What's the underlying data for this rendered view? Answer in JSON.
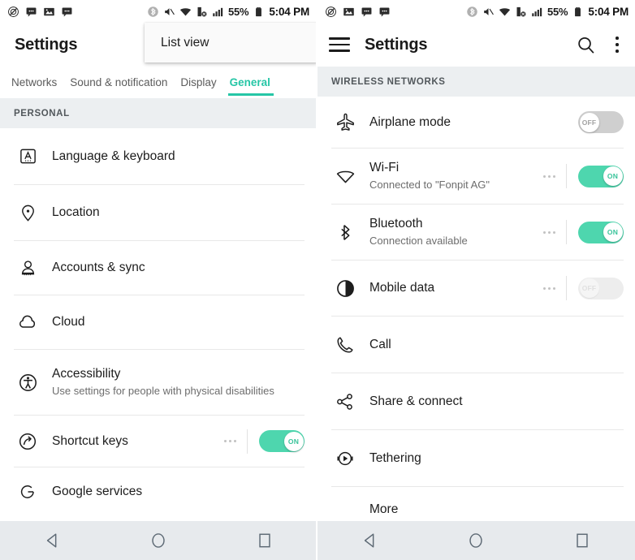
{
  "status_bar": {
    "left_icons_panel1": [
      "no-sound-icon",
      "message-icon",
      "photo-icon",
      "message-icon"
    ],
    "left_icons_panel2": [
      "no-sound-icon",
      "photo-icon",
      "message-icon",
      "message-icon"
    ],
    "bluetooth_icon": "bluetooth-icon",
    "mute_icon": "volume-mute-icon",
    "wifi_icon": "wifi-icon",
    "data_off_icon": "mobile-data-off-icon",
    "signal_icon": "signal-bars-icon",
    "battery_percent": "55%",
    "battery_icon": "battery-icon",
    "time": "5:04 PM"
  },
  "colors": {
    "accent": "#26c6a6",
    "toggle_on": "#4ed6ae",
    "toggle_off": "#cfcfcf",
    "section_bg": "#eceff1",
    "navbar_bg": "#e7eaed"
  },
  "left_panel": {
    "title": "Settings",
    "popup": {
      "label": "List view"
    },
    "tabs": [
      {
        "label": "Networks",
        "active": false
      },
      {
        "label": "Sound & notification",
        "active": false
      },
      {
        "label": "Display",
        "active": false
      },
      {
        "label": "General",
        "active": true
      }
    ],
    "section": {
      "label": "PERSONAL"
    },
    "items": [
      {
        "icon": "language-keyboard-icon",
        "label": "Language & keyboard",
        "sub": null,
        "toggle": null
      },
      {
        "icon": "location-pin-icon",
        "label": "Location",
        "sub": null,
        "toggle": null
      },
      {
        "icon": "accounts-sync-icon",
        "label": "Accounts & sync",
        "sub": null,
        "toggle": null
      },
      {
        "icon": "cloud-icon",
        "label": "Cloud",
        "sub": null,
        "toggle": null
      },
      {
        "icon": "accessibility-icon",
        "label": "Accessibility",
        "sub": "Use settings for people with physical disabilities",
        "toggle": null
      },
      {
        "icon": "shortcut-keys-icon",
        "label": "Shortcut keys",
        "sub": null,
        "toggle": "on",
        "toggle_label": "ON"
      },
      {
        "icon": "google-services-icon",
        "label": "Google services",
        "sub": null,
        "toggle": null
      }
    ]
  },
  "right_panel": {
    "title": "Settings",
    "menu_icon": "hamburger-icon",
    "search_icon": "search-icon",
    "overflow_icon": "overflow-menu-icon",
    "section": {
      "label": "WIRELESS NETWORKS"
    },
    "items": [
      {
        "icon": "airplane-icon",
        "label": "Airplane mode",
        "sub": null,
        "toggle": "off",
        "toggle_label": "OFF",
        "dots": false
      },
      {
        "icon": "wifi-icon",
        "label": "Wi-Fi",
        "sub": "Connected to \"Fonpit AG\"",
        "toggle": "on",
        "toggle_label": "ON",
        "dots": true
      },
      {
        "icon": "bluetooth-icon",
        "label": "Bluetooth",
        "sub": "Connection available",
        "toggle": "on",
        "toggle_label": "ON",
        "dots": true
      },
      {
        "icon": "mobile-data-icon",
        "label": "Mobile data",
        "sub": null,
        "toggle": "disabled",
        "toggle_label": "OFF",
        "dots": true
      },
      {
        "icon": "call-icon",
        "label": "Call",
        "sub": null,
        "toggle": null,
        "dots": false
      },
      {
        "icon": "share-connect-icon",
        "label": "Share & connect",
        "sub": null,
        "toggle": null,
        "dots": false
      },
      {
        "icon": "tethering-icon",
        "label": "Tethering",
        "sub": null,
        "toggle": null,
        "dots": false
      },
      {
        "icon": null,
        "label": "More",
        "sub": null,
        "toggle": null,
        "dots": false
      }
    ]
  },
  "nav_bar": {
    "back": "back-triangle-icon",
    "home": "home-circle-icon",
    "recents": "recents-square-icon"
  }
}
